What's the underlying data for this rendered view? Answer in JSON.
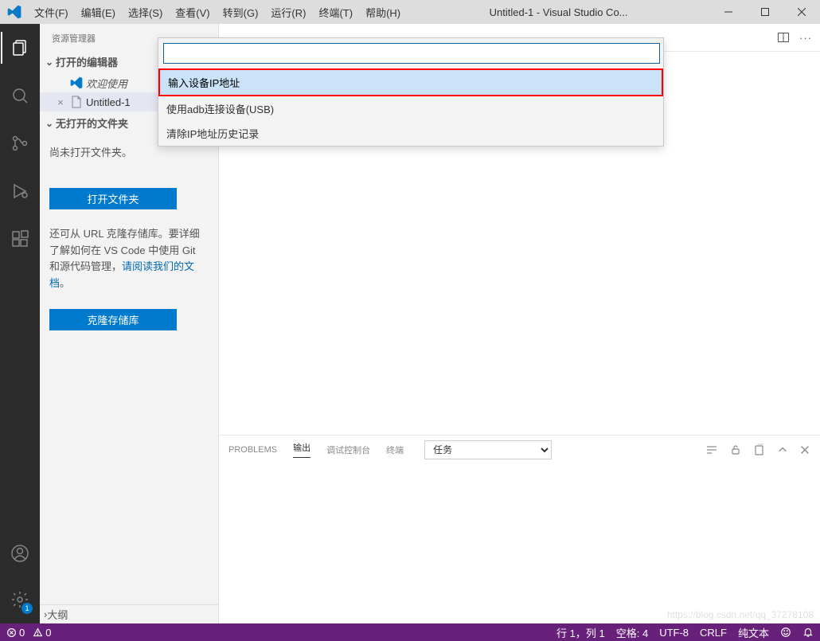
{
  "title": "Untitled-1 - Visual Studio Co...",
  "menus": [
    "文件(F)",
    "编辑(E)",
    "选择(S)",
    "查看(V)",
    "转到(G)",
    "运行(R)",
    "终端(T)",
    "帮助(H)"
  ],
  "sidebar": {
    "header": "资源管理器",
    "open_editors_hdr": "打开的编辑器",
    "editors": [
      {
        "label": "欢迎使用",
        "close": ""
      },
      {
        "label": "Untitled-1",
        "close": "×",
        "active": true
      }
    ],
    "no_folder_hdr": "无打开的文件夹",
    "no_folder_text": "尚未打开文件夹。",
    "open_folder_btn": "打开文件夹",
    "clone_text_pre": "还可从 URL 克隆存储库。要详细了解如何在 VS Code 中使用 Git 和源代码管理，",
    "clone_link": "请阅读我们的文档",
    "clone_text_post": "。",
    "clone_btn": "克隆存储库",
    "outline_hdr": "大纲"
  },
  "palette": {
    "items": [
      "输入设备IP地址",
      "使用adb连接设备(USB)",
      "清除IP地址历史记录"
    ]
  },
  "panel": {
    "tabs": [
      "PROBLEMS",
      "输出",
      "调试控制台",
      "终端"
    ],
    "active": 1,
    "select": "任务"
  },
  "status": {
    "errors": "0",
    "warnings": "0",
    "ln_col": "行 1，列 1",
    "spaces": "空格: 4",
    "encoding": "UTF-8",
    "eol": "CRLF",
    "lang": "纯文本"
  },
  "watermark": "https://blog.csdn.net/qq_37278108",
  "gear_badge": "1"
}
